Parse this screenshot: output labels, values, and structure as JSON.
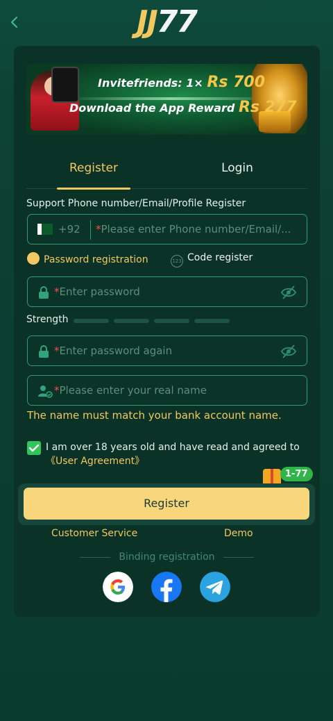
{
  "header": {
    "logo_text_a": "JJ",
    "logo_text_b": "77",
    "back_icon": "chevron-left-icon"
  },
  "banner": {
    "line1_prefix": "Invitefriends: 1×",
    "line1_amount": "Rs 700",
    "line2_prefix": "Download the App Reward",
    "line2_amount": "Rs 277"
  },
  "tabs": [
    {
      "label": "Register",
      "active": true
    },
    {
      "label": "Login",
      "active": false
    }
  ],
  "form": {
    "support_label": "Support Phone number/Email/Profile Register",
    "country_code": "+92",
    "phone_placeholder": "Please enter Phone number/Email/...",
    "mode_password": "Password registration",
    "mode_code": "Code register",
    "mode_code_icon_text": "123",
    "password_placeholder": "Enter password",
    "strength_label": "Strength",
    "strength_level": 0,
    "password_again_placeholder": "Enter password again",
    "realname_placeholder": "Please enter your real name",
    "name_hint": "The name must match your bank account name.",
    "agree_text": "I am over 18 years old and have read and agreed to",
    "agree_link": "《User Agreement》",
    "agree_checked": true,
    "bonus_badge": "1-77",
    "register_button": "Register"
  },
  "links": {
    "customer_service": "Customer Service",
    "demo": "Demo"
  },
  "binding": {
    "label": "Binding registration",
    "providers": [
      "google-icon",
      "facebook-icon",
      "telegram-icon"
    ]
  },
  "colors": {
    "accent": "#f2c861",
    "field_border": "#2f9c76",
    "button": "#f8d77c",
    "check": "#2fc55a"
  }
}
